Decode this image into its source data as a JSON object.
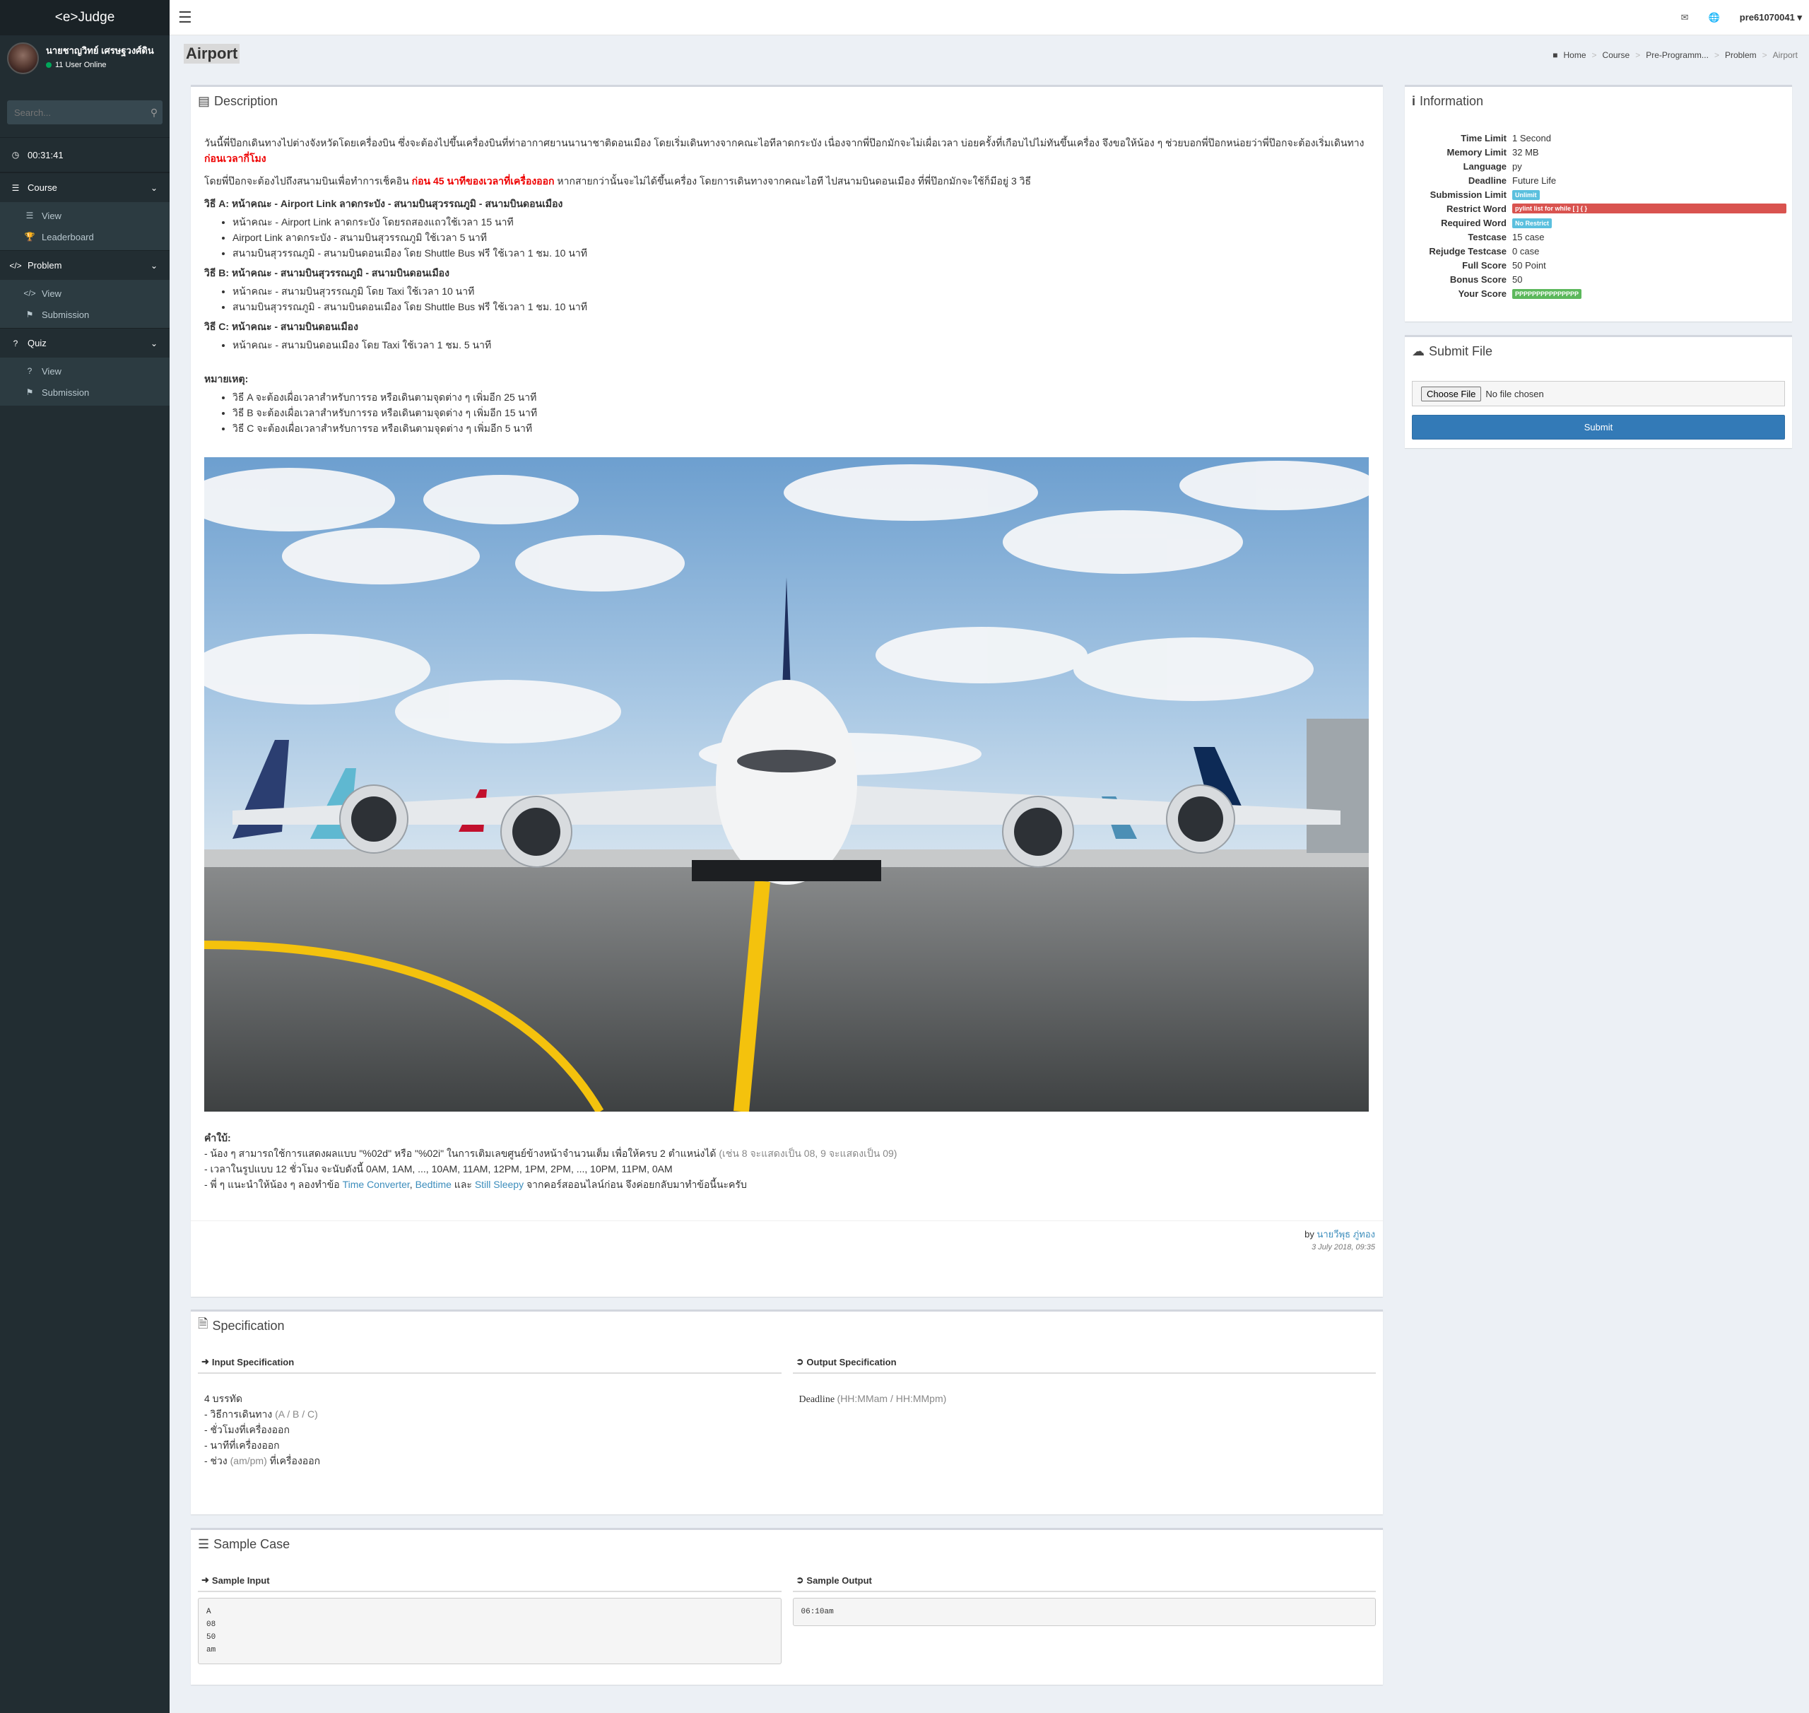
{
  "app": {
    "logo": "<e>Judge"
  },
  "user": {
    "name": "นายชาญวิทย์ เศรษฐวงศ์ดิน",
    "online": "11 User Online",
    "username": "pre61070041"
  },
  "search": {
    "placeholder": "Search..."
  },
  "timer": "00:31:41",
  "nav": {
    "course": {
      "label": "Course",
      "items": [
        "View",
        "Leaderboard"
      ]
    },
    "problem": {
      "label": "Problem",
      "items": [
        "View",
        "Submission"
      ]
    },
    "quiz": {
      "label": "Quiz",
      "items": [
        "View",
        "Submission"
      ]
    }
  },
  "page": {
    "title": "Airport"
  },
  "breadcrumb": [
    "Home",
    "Course",
    "Pre-Programm...",
    "Problem",
    "Airport"
  ],
  "description": {
    "header": "Description",
    "intro_1": "วันนี้พี่ป๊อกเดินทางไปต่างจังหวัดโดยเครื่องบิน ซึ่งจะต้องไปขึ้นเครื่องบินที่ท่าอากาศยานนานาชาติดอนเมือง โดยเริ่มเดินทางจากคณะไอทีลาดกระบัง เนื่องจากพี่ป๊อกมักจะไม่เผื่อเวลา บ่อยครั้งที่เกือบไปไม่ทันขึ้นเครื่อง จึงขอให้น้อง ๆ ช่วยบอกพี่ป๊อกหน่อยว่าพี่ป๊อกจะต้องเริ่มเดินทาง",
    "intro_1_red": "ก่อนเวลากี่โมง",
    "intro_2a": "โดยพี่ป๊อกจะต้องไปถึงสนามบินเพื่อทำการเช็คอิน ",
    "intro_2_red": "ก่อน 45 นาทีของเวลาที่เครื่องออก",
    "intro_2b": " หากสายกว่านั้นจะไม่ได้ขึ้นเครื่อง โดยการเดินทางจากคณะไอที ไปสนามบินดอนเมือง ที่พี่ป๊อกมักจะใช้ก็มีอยู่ 3 วิธี",
    "route_a": "วิธี A: หน้าคณะ - Airport Link ลาดกระบัง - สนามบินสุวรรณภูมิ - สนามบินดอนเมือง",
    "route_a_items": [
      "หน้าคณะ - Airport Link ลาดกระบัง โดยรถสองแถวใช้เวลา 15 นาที",
      "Airport Link ลาดกระบัง - สนามบินสุวรรณภูมิ ใช้เวลา 5 นาที",
      "สนามบินสุวรรณภูมิ - สนามบินดอนเมือง โดย Shuttle Bus ฟรี ใช้เวลา 1 ชม. 10 นาที"
    ],
    "route_b": "วิธี B: หน้าคณะ - สนามบินสุวรรณภูมิ - สนามบินดอนเมือง",
    "route_b_items": [
      "หน้าคณะ - สนามบินสุวรรณภูมิ โดย Taxi ใช้เวลา 10 นาที",
      "สนามบินสุวรรณภูมิ - สนามบินดอนเมือง โดย Shuttle Bus ฟรี ใช้เวลา 1 ชม. 10 นาที"
    ],
    "route_c": "วิธี C: หน้าคณะ - สนามบินดอนเมือง",
    "route_c_items": [
      "หน้าคณะ - สนามบินดอนเมือง โดย Taxi ใช้เวลา 1 ชม. 5 นาที"
    ],
    "note_title": "หมายเหตุ:",
    "note_items": [
      "วิธี A จะต้องเผื่อเวลาสำหรับการรอ หรือเดินตามจุดต่าง ๆ เพิ่มอีก 25 นาที",
      "วิธี B จะต้องเผื่อเวลาสำหรับการรอ หรือเดินตามจุดต่าง ๆ เพิ่มอีก 15 นาที",
      "วิธี C จะต้องเผื่อเวลาสำหรับการรอ หรือเดินตามจุดต่าง ๆ เพิ่มอีก 5 นาที"
    ],
    "hint_title": "คำใบ้:",
    "hint_1a": "- น้อง ๆ สามารถใช้การแสดงผลแบบ \"%02d\" หรือ \"%02i\" ในการเติมเลขศูนย์ข้างหน้าจำนวนเต็ม เพื่อให้ครบ 2 ตำแหน่งได้ ",
    "hint_1b": "(เช่น 8 จะแสดงเป็น 08, 9 จะแสดงเป็น 09)",
    "hint_2": "- เวลาในรูปแบบ 12 ชั่วโมง จะนับดังนี้ 0AM, 1AM, ..., 10AM, 11AM, 12PM, 1PM, 2PM, ..., 10PM, 11PM, 0AM",
    "hint_3a": "- พี่ ๆ แนะนำให้น้อง ๆ ลองทำข้อ ",
    "hint_3_link1": "Time Converter",
    "hint_3_sep": ", ",
    "hint_3_link2": "Bedtime",
    "hint_3_and": " และ ",
    "hint_3_link3": "Still Sleepy",
    "hint_3b": " จากคอร์สออนไลน์ก่อน จึงค่อยกลับมาทำข้อนี้นะครับ",
    "author_by": "by ",
    "author_name": "นายวีพุธ ภู่ทอง",
    "author_date": "3 July 2018, 09:35"
  },
  "information": {
    "header": "Information",
    "rows": [
      {
        "k": "Time Limit",
        "v": "1 Second"
      },
      {
        "k": "Memory Limit",
        "v": "32 MB"
      },
      {
        "k": "Language",
        "v": "py"
      },
      {
        "k": "Deadline",
        "v": "Future Life"
      }
    ],
    "submission_limit_label": "Submission Limit",
    "submission_limit": "Unlimit",
    "restrict_word_label": "Restrict Word",
    "restrict_word": "pylint list for while [ ] { }",
    "required_word_label": "Required Word",
    "required_word": "No Restrict",
    "rows2": [
      {
        "k": "Testcase",
        "v": "15 case"
      },
      {
        "k": "Rejudge Testcase",
        "v": "0 case"
      },
      {
        "k": "Full Score",
        "v": "50 Point"
      },
      {
        "k": "Bonus Score",
        "v": "50"
      }
    ],
    "your_score_label": "Your Score",
    "your_score": "PPPPPPPPPPPPPPP"
  },
  "submit": {
    "header": "Submit File",
    "choose_file": "Choose File",
    "no_file": "No file chosen",
    "button": "Submit"
  },
  "specification": {
    "header": "Specification",
    "input_head": "Input Specification",
    "output_head": "Output Specification",
    "input_lines": [
      "4 บรรทัด",
      "- วิธีการเดินทาง ",
      "- ชั่วโมงที่เครื่องออก",
      "- นาทีที่เครื่องออก",
      "- ช่วง "
    ],
    "input_gray_1": "(A / B / C)",
    "input_gray_5": "(am/pm)",
    "input_tail_5": " ที่เครื่องออก",
    "output_text": "Deadline ",
    "output_gray": "(HH:MMam / HH:MMpm)"
  },
  "sample": {
    "header": "Sample Case",
    "input_head": "Sample Input",
    "output_head": "Sample Output",
    "input": "A\n08\n50\nam",
    "output": "06:10am"
  },
  "colors": {
    "sidebar": "#222d32",
    "link": "#3c8dbc",
    "danger": "#d9534f",
    "info": "#5bc0de",
    "success": "#5cb85c",
    "primary": "#337ab7"
  }
}
